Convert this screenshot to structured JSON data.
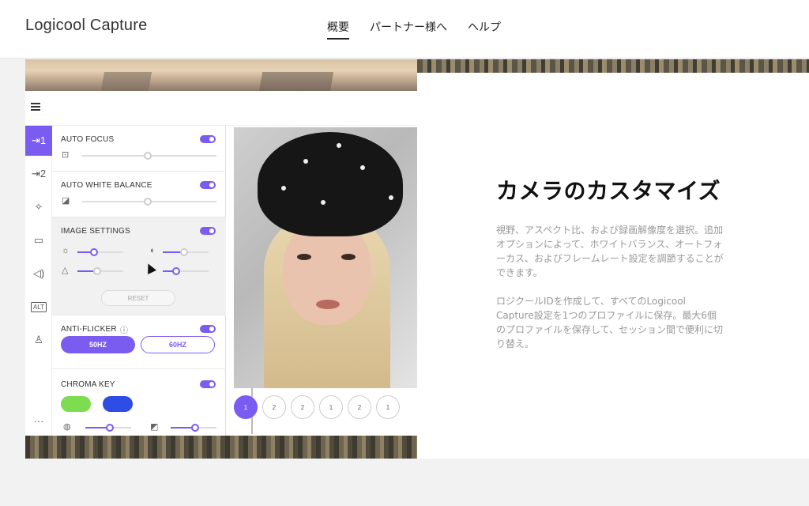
{
  "header": {
    "brand": "Logicool Capture",
    "nav": [
      "概要",
      "パートナー様へ",
      "ヘルプ"
    ],
    "active_nav": "概要"
  },
  "app": {
    "rail": {
      "alt_label": "ALT",
      "icons": [
        "source-1-icon",
        "source-2-icon",
        "magic-wand-icon",
        "video-icon",
        "audio-icon",
        "alt-icon",
        "user-icon",
        "more-icon"
      ]
    },
    "sections": {
      "auto_focus": "AUTO FOCUS",
      "auto_white_balance": "AUTO WHITE BALANCE",
      "image_settings": "IMAGE SETTINGS",
      "reset": "RESET",
      "anti_flicker": "ANTI-FLICKER",
      "hz_50": "50HZ",
      "hz_60": "60HZ",
      "chroma_key": "CHROMA KEY"
    },
    "swatch_colors": [
      "#7ddc4f",
      "#2e4de6"
    ],
    "accent": "#7b5cf0",
    "layout_buttons": [
      "1",
      "2",
      "2",
      "1",
      "2",
      "1"
    ]
  },
  "content": {
    "headline": "カメラのカスタマイズ",
    "paragraph_1": "視野、アスペクト比、および録画解像度を選択。追加オプションによって、ホワイトバランス、オートフォーカス、およびフレームレート設定を調節することができます。",
    "paragraph_2": "ロジクールIDを作成して、すべてのLogicool Capture設定を1つのプロファイルに保存。最大6個のプロファイルを保存して、セッション間で便利に切り替え。"
  }
}
